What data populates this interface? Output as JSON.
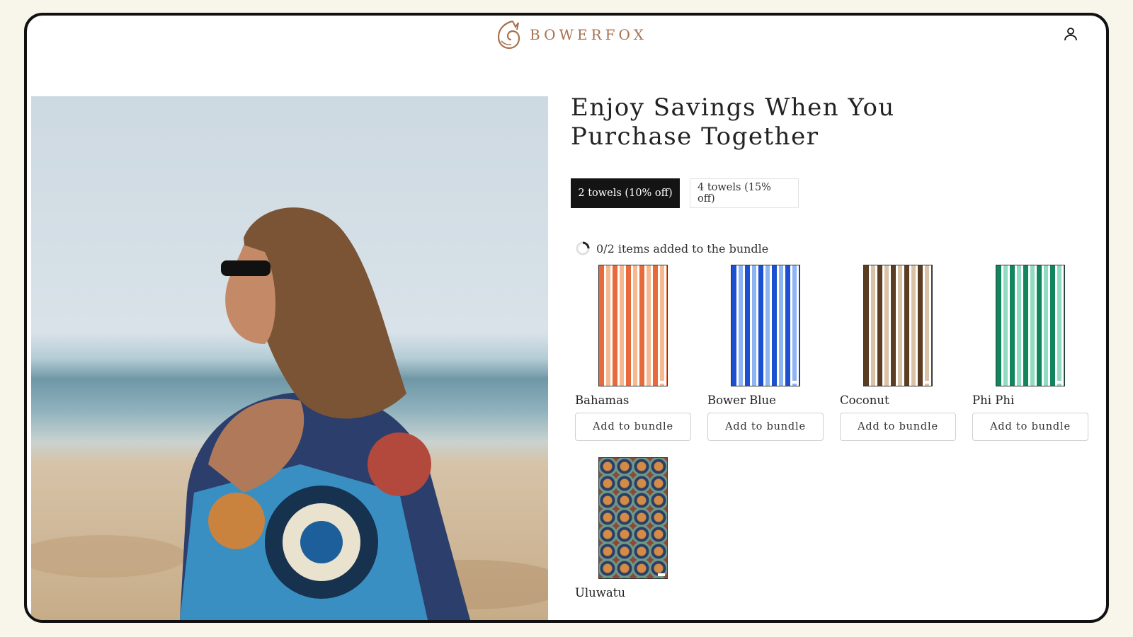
{
  "header": {
    "brand": "BOWERFOX",
    "account_icon": "account-icon"
  },
  "hero": {
    "alt": "Woman on beach wrapped in patterned towel"
  },
  "bundle": {
    "title": "Enjoy Savings When You Purchase Together",
    "tabs": [
      {
        "label": "2 towels (10% off)",
        "active": true
      },
      {
        "label": "4 towels (15% off)",
        "active": false
      }
    ],
    "progress_text": "0/2 items added to the bundle",
    "progress_fraction": 0,
    "products": [
      {
        "name": "Bahamas",
        "button": "Add to bundle",
        "colors": [
          "#e86a3a",
          "#f6b88f"
        ]
      },
      {
        "name": "Bower Blue",
        "button": "Add to bundle",
        "colors": [
          "#1d4fd1",
          "#8fb4f2"
        ]
      },
      {
        "name": "Coconut",
        "button": "Add to bundle",
        "colors": [
          "#5a3d22",
          "#d9c2a5"
        ]
      },
      {
        "name": "Phi Phi",
        "button": "Add to bundle",
        "colors": [
          "#12845e",
          "#8fdcc0"
        ]
      },
      {
        "name": "Uluwatu",
        "button": "Add to bundle",
        "colors": [
          "#2b3e66",
          "#d38b45"
        ]
      }
    ]
  },
  "colors": {
    "brand": "#a8714e",
    "active_tab": "#141414"
  }
}
